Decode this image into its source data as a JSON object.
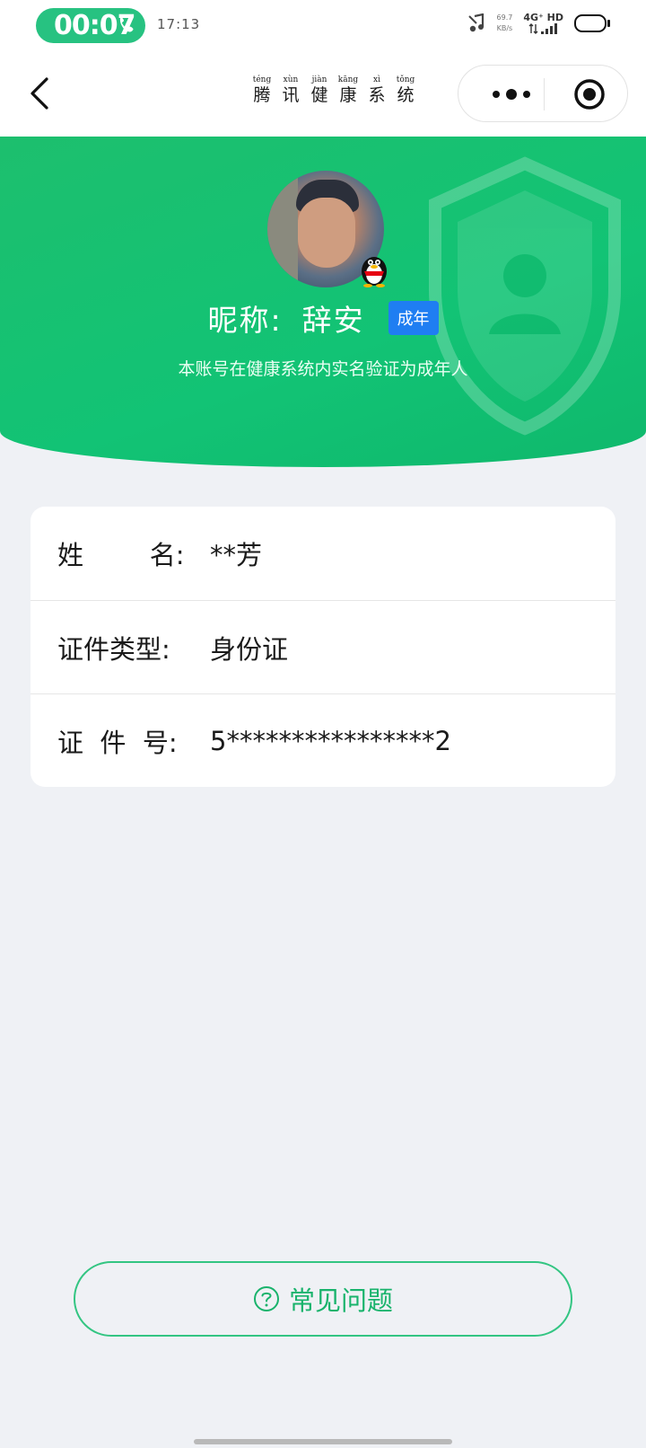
{
  "status_bar": {
    "call_timer": "00:07",
    "clock": "17:13",
    "net_speed_value": "69.7",
    "net_speed_unit": "KB/s",
    "network_type": "4G⁺ HD",
    "icons": [
      "phone-icon",
      "music-icon",
      "signal-icon",
      "battery-icon"
    ]
  },
  "nav": {
    "title_chars": [
      {
        "pinyin": "téng",
        "hanzi": "腾"
      },
      {
        "pinyin": "xùn",
        "hanzi": "讯"
      },
      {
        "pinyin": "jiàn",
        "hanzi": "健"
      },
      {
        "pinyin": "kāng",
        "hanzi": "康"
      },
      {
        "pinyin": "xì",
        "hanzi": "系"
      },
      {
        "pinyin": "tǒng",
        "hanzi": "统"
      }
    ],
    "icons": [
      "back-icon",
      "more-icon",
      "target-icon"
    ]
  },
  "profile": {
    "nickname_label": "昵称:",
    "nickname": "辞安",
    "badge": "成年",
    "verify_text": "本账号在健康系统内实名验证为成年人"
  },
  "info": {
    "rows": [
      {
        "label": "姓        名:",
        "value": "**芳"
      },
      {
        "label": "证件类型:",
        "value": "身份证"
      },
      {
        "label": "证  件  号:",
        "value": "5****************2"
      }
    ]
  },
  "faq": {
    "label": "常见问题"
  },
  "colors": {
    "brand_green": "#12c375",
    "badge_blue": "#1f7ef2",
    "faq_green": "#19b36c",
    "background": "#eff1f5"
  }
}
